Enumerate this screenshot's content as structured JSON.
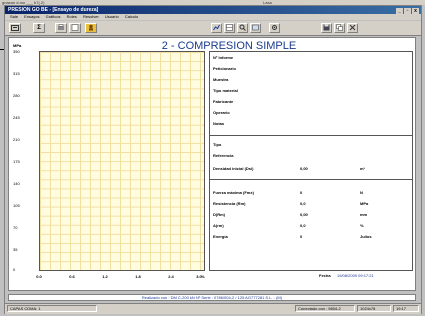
{
  "top_strip": {
    "left": "gnazan d.mo  ___  b7(.2)",
    "right": "Lasa"
  },
  "window": {
    "title": "PRESION GO BE - [Ensayo de dureza]",
    "controls": [
      "_",
      "▫",
      "x"
    ]
  },
  "menu": [
    "Sale",
    "Ensayos",
    "Gráficos",
    "Roles",
    "Resolver",
    "Usuario",
    "Calculo"
  ],
  "toolbar": {
    "buttons": [
      "",
      "Σ",
      "",
      "",
      ""
    ]
  },
  "report": {
    "title": "2 - COMPRESION SIMPLE",
    "y_unit": "MPa",
    "y_ticks": [
      "350",
      "315",
      "280",
      "245",
      "210",
      "175",
      "140",
      "105",
      "70",
      "35",
      "0"
    ],
    "x_ticks": [
      "0.0",
      "0.6",
      "1.2",
      "1.8",
      "2.4",
      "3.0"
    ],
    "x_unit": "%",
    "info_top": [
      "Nº Informe",
      "Peticionario",
      "Muestra",
      "Tipo material",
      "Fabricante",
      "Operario",
      "Notas"
    ],
    "info_mid": {
      "labels": [
        "Tipo",
        "Referencia",
        "Densidad inicial (Dsi)"
      ],
      "value": "0,00",
      "unit": "m³"
    },
    "info_bot": [
      {
        "label": "Fuerza máxima (Fmx)",
        "value": "0",
        "unit": "N"
      },
      {
        "label": "Resistencia (Rm)",
        "value": "0,0",
        "unit": "MPa"
      },
      {
        "label": "D(Rm)",
        "value": "0,00",
        "unit": "mm"
      },
      {
        "label": "A(rm)",
        "value": "0,0",
        "unit": "%"
      },
      {
        "label": "Energía",
        "value": "0",
        "unit": "Julios"
      }
    ],
    "date_label": "Fecha",
    "date_value": "19/08/2009 09:17:21",
    "footnote": "Realizado con : DM C-200 kN Nº Serie : 0786/004-2 / 125 AG777281 S.L. - (M)"
  },
  "statusbar": [
    "CAPAS CDMA: 1",
    "Conectado con : 9804-2",
    "1024x76",
    "19:17"
  ]
}
